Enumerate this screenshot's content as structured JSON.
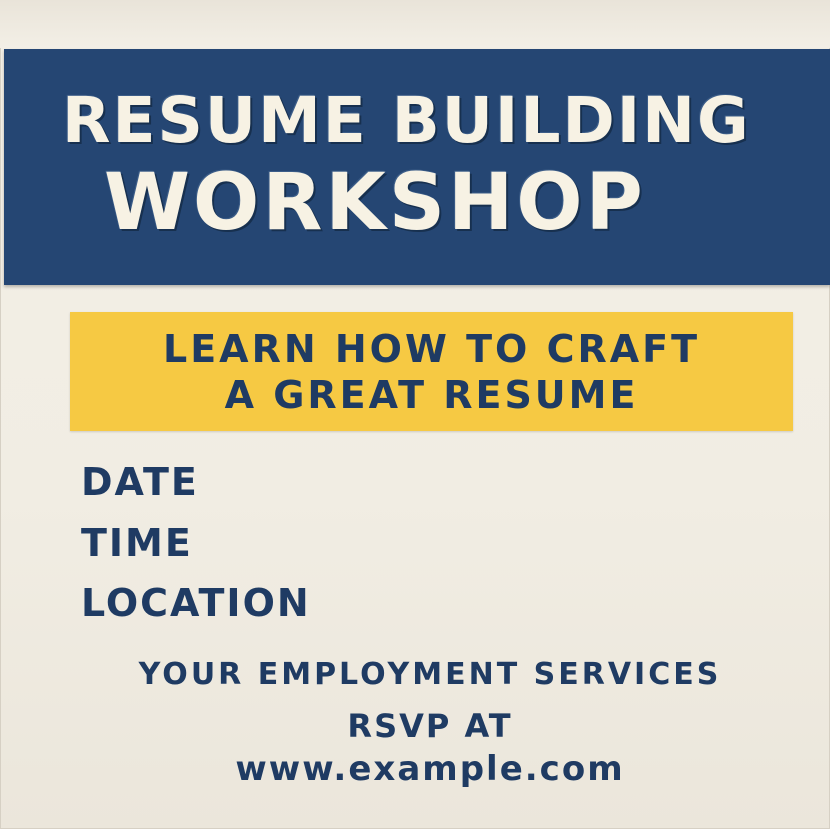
{
  "banner": {
    "line1": "RESUME BUILDING",
    "line2": "WORKSHOP"
  },
  "subtitle": {
    "line1": "LEARN HOW TO CRAFT",
    "line2": "A GREAT RESUME"
  },
  "details": {
    "date_label": "DATE",
    "time_label": "TIME",
    "location_label": "LOCATION"
  },
  "footer": {
    "organizer": "YOUR EMPLOYMENT SERVICES",
    "rsvp": "RSVP AT",
    "url": "www.example.com"
  },
  "colors": {
    "banner": "#254673",
    "accent": "#f6c943",
    "text": "#1f3b63",
    "paper": "#f3efe6"
  }
}
